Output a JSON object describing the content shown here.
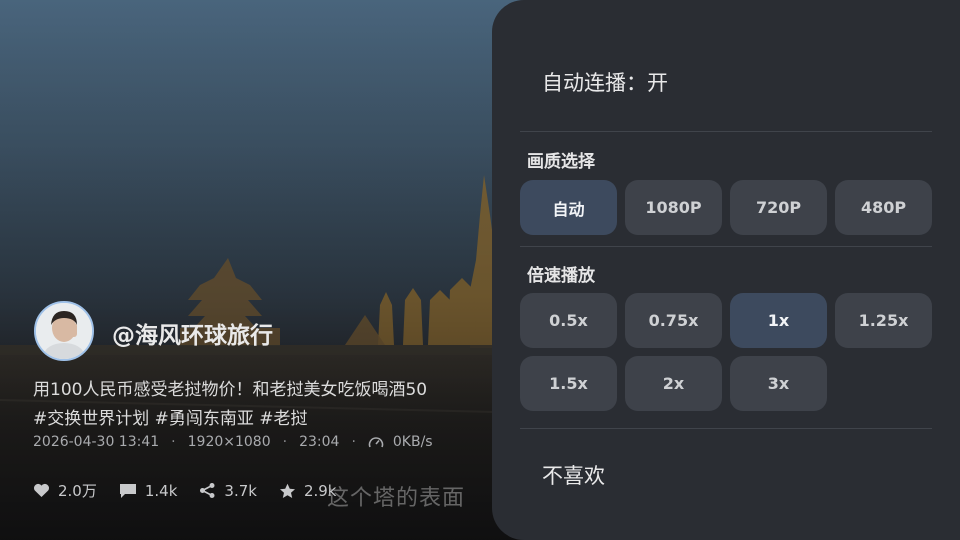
{
  "video": {
    "channel": "@海风环球旅行",
    "title_line1": "用100人民币感受老挝物价！和老挝美女吃饭喝酒50",
    "title_line2": "#交换世界计划  #勇闯东南亚 #老挝",
    "date": "2026-04-30 13:41",
    "resolution": "1920×1080",
    "duration": "23:04",
    "net_speed": "0KB/s",
    "likes": "2.0万",
    "comments": "1.4k",
    "shares": "3.7k",
    "favorites": "2.9k",
    "subtitle": "这个塔的表面"
  },
  "panel": {
    "autoplay": "自动连播：开",
    "quality_title": "画质选择",
    "quality_options": [
      "自动",
      "1080P",
      "720P",
      "480P"
    ],
    "quality_selected": "自动",
    "speed_title": "倍速播放",
    "speed_options": [
      "0.5x",
      "0.75x",
      "1x",
      "1.25x",
      "1.5x",
      "2x",
      "3x"
    ],
    "speed_selected": "1x",
    "dislike": "不喜欢"
  },
  "colors": {
    "panel_bg": "#2a2d33",
    "button_bg": "#3e424a",
    "button_selected_bg": "#3d4a5e",
    "avatar_ring": "#9fc1e8"
  },
  "icons": [
    "heart-icon",
    "comment-icon",
    "share-icon",
    "star-icon",
    "speedometer-icon"
  ]
}
